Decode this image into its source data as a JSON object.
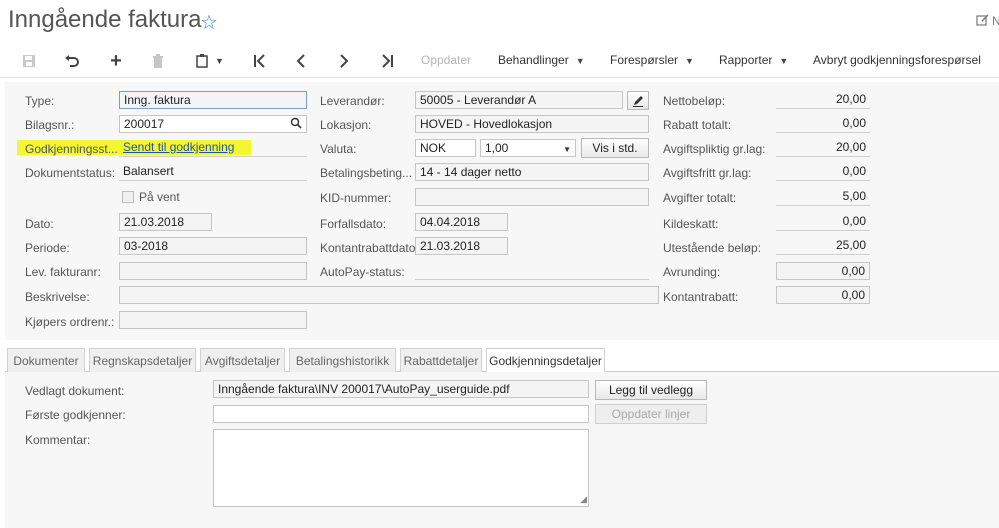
{
  "header": {
    "title": "Inngående faktura",
    "star_glyph": "☆",
    "corner_label": "N"
  },
  "toolbar": {
    "update_label": "Oppdater",
    "menus": [
      {
        "label": "Behandlinger"
      },
      {
        "label": "Forespørsler"
      },
      {
        "label": "Rapporter"
      }
    ],
    "cancel_approval_label": "Avbryt godkjenningsforespørsel"
  },
  "form": {
    "type": {
      "label": "Type:",
      "value": "Inng. faktura"
    },
    "bilagsnr": {
      "label": "Bilagsnr.:",
      "value": "200017"
    },
    "godkjenning": {
      "label": "Godkjenningsst...",
      "value": "Sendt til godkjenning"
    },
    "dokumentstatus": {
      "label": "Dokumentstatus:",
      "value": "Balansert"
    },
    "paa_vent": {
      "label": "På vent",
      "checked": false
    },
    "dato": {
      "label": "Dato:",
      "value": "21.03.2018"
    },
    "periode": {
      "label": "Periode:",
      "value": "03-2018"
    },
    "lev_fakturanr": {
      "label": "Lev. fakturanr:",
      "value": ""
    },
    "beskrivelse": {
      "label": "Beskrivelse:",
      "value": ""
    },
    "kjopers_ordrenr": {
      "label": "Kjøpers ordrenr.:",
      "value": ""
    },
    "leverandor": {
      "label": "Leverandør:",
      "value": "50005 - Leverandør A"
    },
    "lokasjon": {
      "label": "Lokasjon:",
      "value": "HOVED - Hovedlokasjon"
    },
    "valuta": {
      "label": "Valuta:",
      "currency": "NOK",
      "rate": "1,00",
      "button": "Vis i std."
    },
    "betalingsbeting": {
      "label": "Betalingsbeting...",
      "value": "14 - 14 dager netto"
    },
    "kid": {
      "label": "KID-nummer:",
      "value": ""
    },
    "forfallsdato": {
      "label": "Forfallsdato:",
      "value": "04.04.2018"
    },
    "kontantrabattdato": {
      "label": "Kontantrabattdato:",
      "value": "21.03.2018"
    },
    "autopay": {
      "label": "AutoPay-status:",
      "value": ""
    }
  },
  "totals": [
    {
      "label": "Nettobeløp:",
      "value": "20,00",
      "boxed": false
    },
    {
      "label": "Rabatt totalt:",
      "value": "0,00",
      "boxed": false
    },
    {
      "label": "Avgiftspliktig gr.lag:",
      "value": "20,00",
      "boxed": false
    },
    {
      "label": "Avgiftsfritt gr.lag:",
      "value": "0,00",
      "boxed": false
    },
    {
      "label": "Avgifter totalt:",
      "value": "5,00",
      "boxed": false
    },
    {
      "label": "Kildeskatt:",
      "value": "0,00",
      "boxed": false
    },
    {
      "label": "Utestående beløp:",
      "value": "25,00",
      "boxed": false
    },
    {
      "label": "Avrunding:",
      "value": "0,00",
      "boxed": true
    },
    {
      "label": "Kontantrabatt:",
      "value": "0,00",
      "boxed": true
    }
  ],
  "tabs": [
    {
      "label": "Dokumenter",
      "active": false
    },
    {
      "label": "Regnskapsdetaljer",
      "active": false
    },
    {
      "label": "Avgiftsdetaljer",
      "active": false
    },
    {
      "label": "Betalingshistorikk",
      "active": false
    },
    {
      "label": "Rabattdetaljer",
      "active": false
    },
    {
      "label": "Godkjenningsdetaljer",
      "active": true
    }
  ],
  "approval": {
    "vedlagt": {
      "label": "Vedlagt dokument:",
      "value": "Inngående faktura\\INV 200017\\AutoPay_userguide.pdf"
    },
    "add_attachment_button": "Legg til vedlegg",
    "forste_godkjenner": {
      "label": "Første godkjenner:",
      "value": ""
    },
    "update_lines_button": "Oppdater linjer",
    "kommentar": {
      "label": "Kommentar:",
      "value": ""
    }
  },
  "colors": {
    "highlight": "#f5f532",
    "link": "#1a55b5",
    "star": "#3a8bd8"
  }
}
